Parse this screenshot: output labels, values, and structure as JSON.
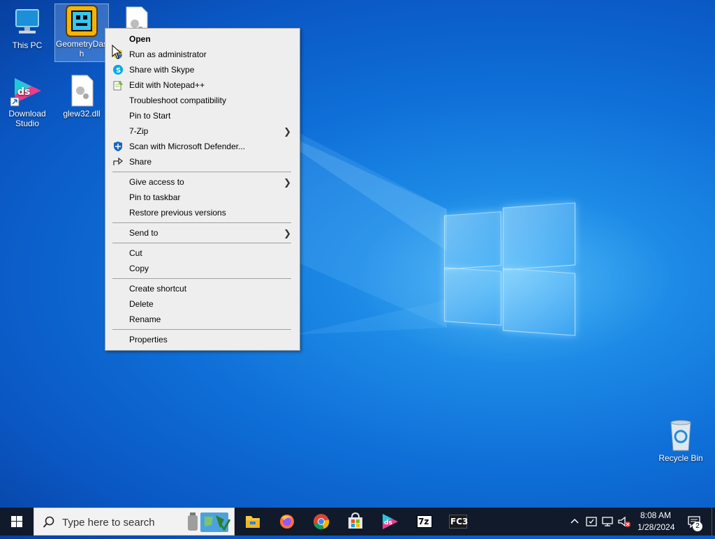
{
  "desktop": {
    "icons": [
      {
        "label": "This PC"
      },
      {
        "label": "GeometryDash"
      },
      {
        "label": "Download Studio"
      },
      {
        "label": "glew32.dll"
      },
      {
        "label": "Recycle Bin"
      }
    ]
  },
  "context_menu": {
    "items": [
      {
        "label": "Open",
        "bold": true
      },
      {
        "label": "Run as administrator",
        "icon": "shield-icon"
      },
      {
        "label": "Share with Skype",
        "icon": "skype-icon"
      },
      {
        "label": "Edit with Notepad++",
        "icon": "notepad-plus-plus-icon"
      },
      {
        "label": "Troubleshoot compatibility"
      },
      {
        "label": "Pin to Start"
      },
      {
        "label": "7-Zip",
        "submenu": true
      },
      {
        "label": "Scan with Microsoft Defender...",
        "icon": "defender-icon"
      },
      {
        "label": "Share",
        "icon": "share-icon"
      },
      {
        "label": "Give access to",
        "submenu": true
      },
      {
        "label": "Pin to taskbar"
      },
      {
        "label": "Restore previous versions"
      },
      {
        "label": "Send to",
        "submenu": true
      },
      {
        "label": "Cut"
      },
      {
        "label": "Copy"
      },
      {
        "label": "Create shortcut"
      },
      {
        "label": "Delete"
      },
      {
        "label": "Rename"
      },
      {
        "label": "Properties"
      }
    ]
  },
  "taskbar": {
    "search_placeholder": "Type here to search",
    "apps": [
      {
        "name": "file-explorer-icon"
      },
      {
        "name": "firefox-icon"
      },
      {
        "name": "chrome-icon"
      },
      {
        "name": "microsoft-store-icon"
      },
      {
        "name": "download-studio-icon"
      },
      {
        "name": "7zip-icon",
        "text": "7z"
      },
      {
        "name": "fc3-icon",
        "text": "FC3"
      }
    ],
    "clock": {
      "time": "8:08 AM",
      "date": "1/28/2024"
    },
    "notifications_count": "2"
  },
  "colors": {
    "taskbar": "#101a2a",
    "menu_bg": "#eeeeee",
    "desktop_accent": "#0f6fd8"
  }
}
